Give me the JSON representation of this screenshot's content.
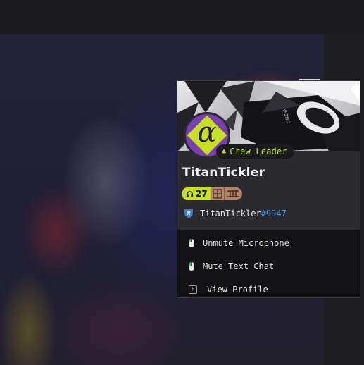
{
  "profile": {
    "role": "Crew Leader",
    "username": "TitanTickler",
    "level": "27",
    "tag_name": "TitanTickler",
    "tag_discriminator": "#9947"
  },
  "menu": {
    "items": [
      {
        "label": "Unmute Microphone",
        "icon": "mouse-left-click-icon"
      },
      {
        "label": "Mute Text Chat",
        "icon": "mouse-left-click-icon"
      },
      {
        "label": "View Profile",
        "icon": "key-f-icon",
        "key": "F"
      }
    ]
  },
  "colors": {
    "accent": "#c8e021",
    "avatar_bg": "#7a3fb0",
    "rank_badge": "#b48468",
    "discriminator": "#4a8fe0"
  }
}
